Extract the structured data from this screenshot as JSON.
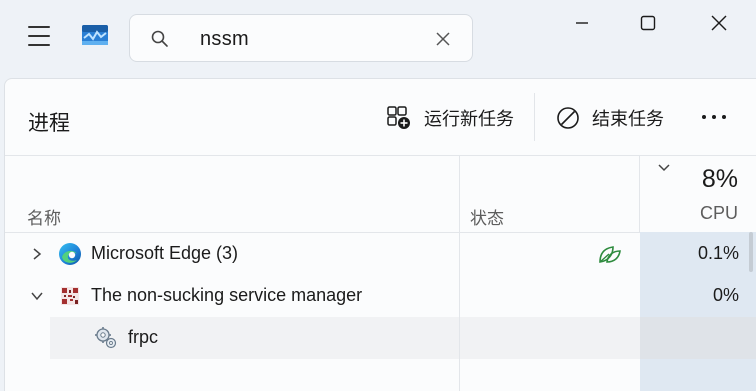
{
  "search": {
    "value": "nssm"
  },
  "page": {
    "title": "进程"
  },
  "toolbar": {
    "run_new_task": "运行新任务",
    "end_task": "结束任务"
  },
  "columns": {
    "name": "名称",
    "status": "状态",
    "cpu_percent": "8%",
    "cpu": "CPU"
  },
  "processes": [
    {
      "name": "Microsoft Edge (3)",
      "cpu": "0.1%",
      "expanded": false,
      "icon": "edge-icon",
      "status_icon": "efficiency-mode-leaf-icon"
    },
    {
      "name": "The non-sucking service manager",
      "cpu": "0%",
      "expanded": true,
      "icon": "nssm-app-icon",
      "children": [
        {
          "name": "frpc",
          "icon": "service-gears-icon"
        }
      ]
    }
  ],
  "colors": {
    "cpu_column": "#dfe8f2",
    "leaf_green": "#2e8b3e",
    "window_bg": "#eef2f7",
    "panel_bg": "#fbfcfd"
  }
}
